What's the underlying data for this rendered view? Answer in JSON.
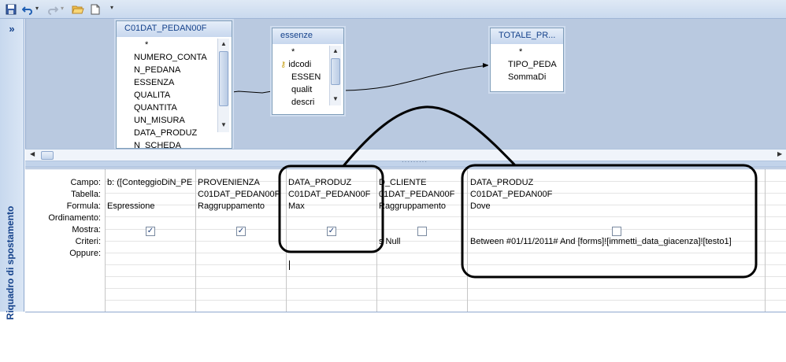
{
  "toolbar": {
    "icons": [
      "save-icon",
      "undo-icon",
      "redo-icon",
      "open-folder-icon",
      "new-document-icon",
      "customize-toolbar-icon"
    ]
  },
  "nav_pane": {
    "expand_label": "»",
    "title": "Riquadro di spostamento"
  },
  "tables": [
    {
      "title": "C01DAT_PEDAN00F",
      "fields": [
        "*",
        "NUMERO_CONTA",
        "N_PEDANA",
        "ESSENZA",
        "QUALITA",
        "QUANTITA",
        "UN_MISURA",
        "DATA_PRODUZ",
        "N_SCHEDA"
      ]
    },
    {
      "title": "essenze",
      "fields": [
        "*",
        "idcodi",
        "ESSEN",
        "qualit",
        "descri"
      ]
    },
    {
      "title": "TOTALE_PR...",
      "fields": [
        "*",
        "TIPO_PEDA",
        "SommaDi"
      ]
    }
  ],
  "grid": {
    "row_labels": [
      "Campo:",
      "Tabella:",
      "Formula:",
      "Ordinamento:",
      "Mostra:",
      "Criteri:",
      "Oppure:"
    ],
    "columns": [
      {
        "campo": "b: ([ConteggioDiN_PE",
        "tabella": "",
        "formula": "Espressione",
        "ordinamento": "",
        "mostra": true,
        "criteri": ""
      },
      {
        "campo": "PROVENIENZA",
        "tabella": "C01DAT_PEDAN00F",
        "formula": "Raggruppamento",
        "ordinamento": "",
        "mostra": true,
        "criteri": ""
      },
      {
        "campo": "DATA_PRODUZ",
        "tabella": "C01DAT_PEDAN00F",
        "formula": "Max",
        "ordinamento": "",
        "mostra": true,
        "criteri": ""
      },
      {
        "campo": "D_CLIENTE",
        "tabella": "01DAT_PEDAN00F",
        "formula": "Raggruppamento",
        "ordinamento": "",
        "mostra": false,
        "criteri": "s Null"
      },
      {
        "campo": "DATA_PRODUZ",
        "tabella": "C01DAT_PEDAN00F",
        "formula": "Dove",
        "ordinamento": "",
        "mostra": false,
        "criteri": "Between #01/11/2011# And [forms]![immetti_data_giacenza]![testo1]"
      }
    ]
  }
}
